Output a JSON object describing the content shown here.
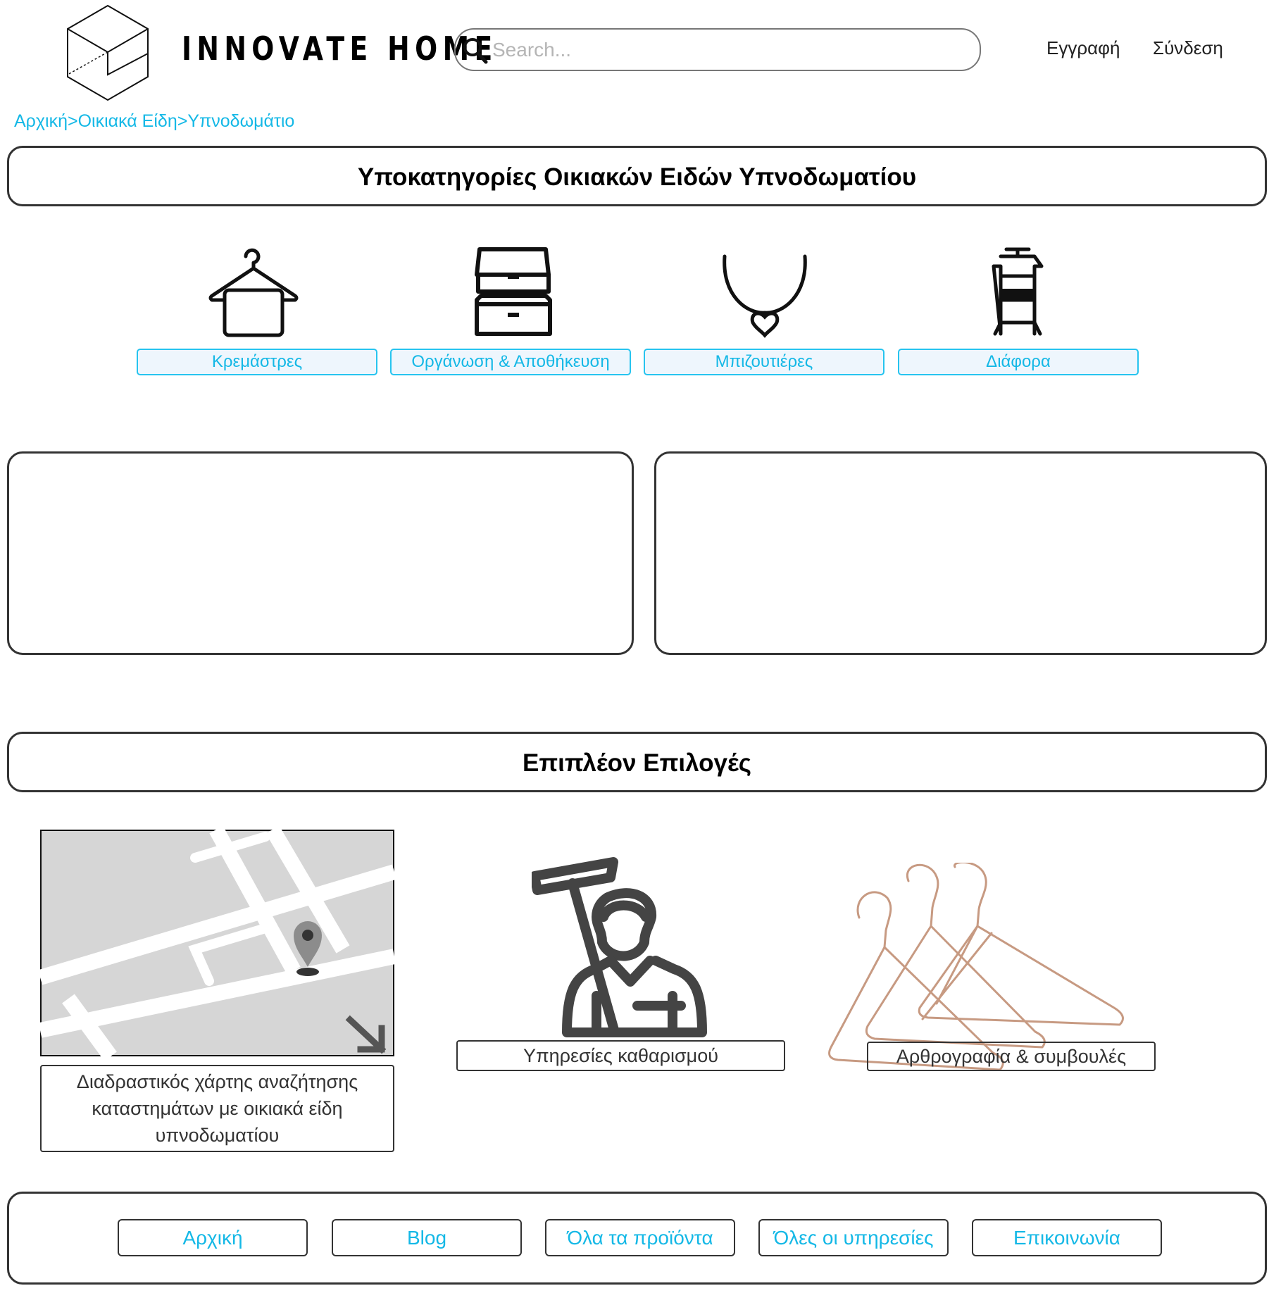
{
  "header": {
    "brand": "INNOVATE HOME",
    "search_placeholder": "Search...",
    "register": "Εγγραφή",
    "login": "Σύνδεση"
  },
  "breadcrumb": "Αρχική>Οικιακά Είδη>Υπνοδωμάτιο",
  "subcategories": {
    "title": "Υποκατηγορίες Οικιακών Ειδών Υπνοδωματίου",
    "items": [
      {
        "label": "Κρεμάστρες",
        "icon": "hanger-icon"
      },
      {
        "label": "Οργάνωση & Αποθήκευση",
        "icon": "storage-drawers-icon"
      },
      {
        "label": "Μπιζουτιέρες",
        "icon": "necklace-icon"
      },
      {
        "label": "Διάφορα",
        "icon": "valet-stand-icon"
      }
    ]
  },
  "more_options": {
    "title": "Επιπλέον Επιλογές",
    "map_label": "Διαδραστικός χάρτης αναζήτησης καταστημάτων με οικιακά είδη υπνοδωματίου",
    "cleaning_label": "Υπηρεσίες καθαρισμού",
    "articles_label": "Αρθρογραφία & συμβουλές"
  },
  "footer_nav": [
    "Αρχική",
    "Blog",
    "Όλα τα προϊόντα",
    "Όλες οι υπηρεσίες",
    "Επικοινωνία"
  ],
  "colors": {
    "link": "#14b8e6",
    "border": "#333333",
    "button_bg": "#eef6fd"
  }
}
